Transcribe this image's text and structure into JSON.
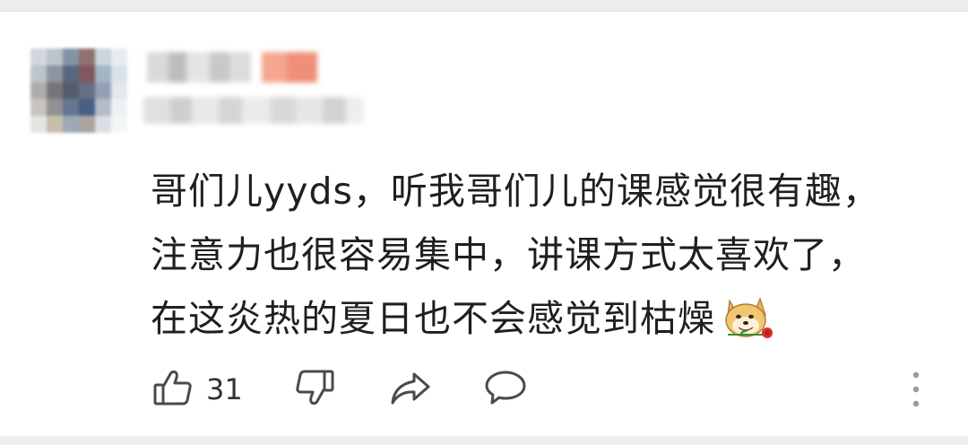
{
  "comment": {
    "lines": [
      "哥们儿yyds，听我哥们儿的课感觉很有趣，",
      "注意力也很容易集中，讲课方式太喜欢了，",
      "在这炎热的夏日也不会感觉到枯燥"
    ],
    "emoji": "doge-rose-emoji"
  },
  "actions": {
    "like_count": "31",
    "like_icon": "thumbs-up-icon",
    "dislike_icon": "thumbs-down-icon",
    "share_icon": "share-icon",
    "reply_icon": "comment-bubble-icon",
    "more_icon": "more-vertical-icon"
  },
  "colors": {
    "text": "#1f1f1f",
    "icon": "#4a4a4a",
    "username_blur": "#f29a83"
  }
}
